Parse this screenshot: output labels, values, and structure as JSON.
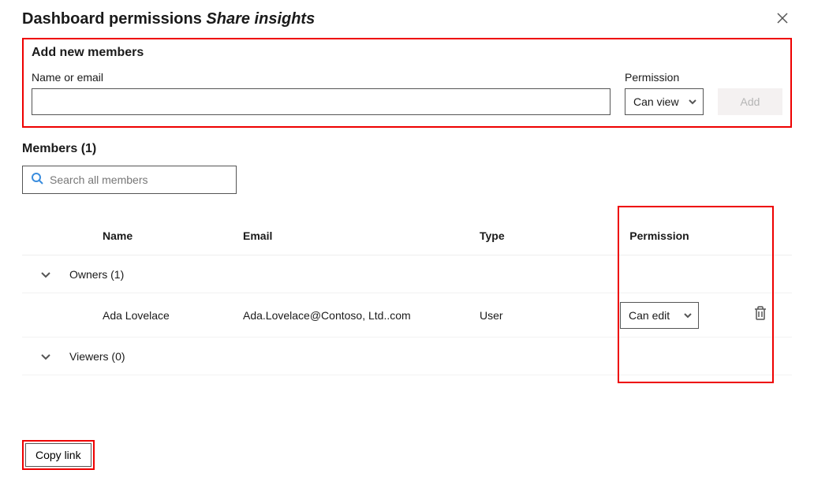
{
  "header": {
    "title_main": "Dashboard permissions",
    "title_sub": "Share insights"
  },
  "add_section": {
    "heading": "Add new members",
    "name_label": "Name or email",
    "name_value": "",
    "permission_label": "Permission",
    "permission_value": "Can view",
    "add_button_label": "Add"
  },
  "members": {
    "heading": "Members (1)",
    "search_placeholder": "Search all members",
    "columns": {
      "name": "Name",
      "email": "Email",
      "type": "Type",
      "permission": "Permission"
    },
    "groups": [
      {
        "label": "Owners (1)",
        "expanded": true,
        "rows": [
          {
            "name": "Ada Lovelace",
            "email": "Ada.Lovelace@Contoso, Ltd..com",
            "type": "User",
            "permission": "Can edit"
          }
        ]
      },
      {
        "label": "Viewers (0)",
        "expanded": true,
        "rows": []
      }
    ]
  },
  "footer": {
    "copy_link_label": "Copy link"
  }
}
